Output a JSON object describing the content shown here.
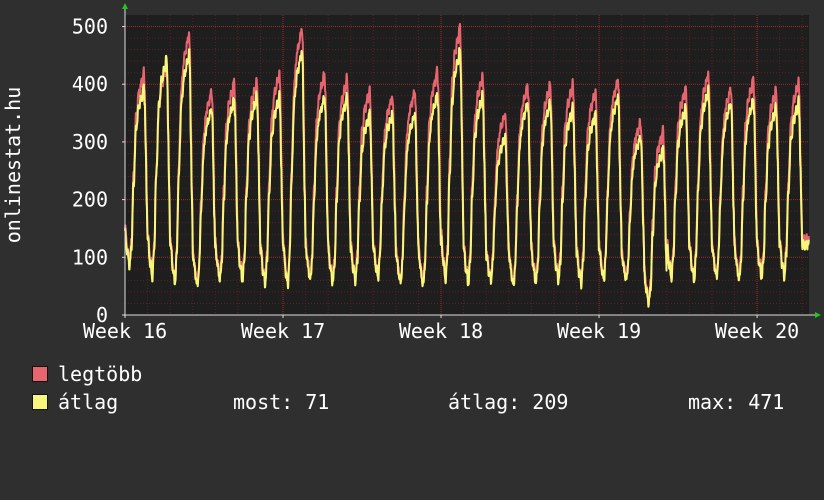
{
  "chart_data": {
    "type": "line",
    "ylabel": "onlinestat.hu",
    "ylim": [
      0,
      520
    ],
    "yticks": [
      0,
      100,
      200,
      300,
      400,
      500
    ],
    "grid": true,
    "xticks": [
      {
        "label": "Week 16",
        "at": 0
      },
      {
        "label": "Week 17",
        "at": 7
      },
      {
        "label": "Week 18",
        "at": 14
      },
      {
        "label": "Week 19",
        "at": 21
      },
      {
        "label": "Week 20",
        "at": 28
      }
    ],
    "xlim": [
      0,
      30.3
    ],
    "series": [
      {
        "name": "legtöbb",
        "color": "#e8656f",
        "daily_peak": [
          420,
          435,
          490,
          390,
          405,
          405,
          420,
          500,
          420,
          410,
          390,
          380,
          390,
          425,
          500,
          415,
          350,
          400,
          400,
          400,
          390,
          410,
          335,
          320,
          395,
          420,
          395,
          410,
          390,
          405
        ],
        "daily_low": [
          90,
          75,
          60,
          55,
          65,
          65,
          60,
          55,
          65,
          60,
          65,
          70,
          60,
          55,
          65,
          60,
          65,
          55,
          60,
          65,
          60,
          65,
          65,
          25,
          70,
          65,
          70,
          65,
          70,
          70
        ]
      },
      {
        "name": "átlag",
        "color": "#f7f77b",
        "daily_peak": [
          395,
          445,
          455,
          360,
          375,
          380,
          380,
          460,
          380,
          380,
          350,
          350,
          350,
          385,
          460,
          380,
          310,
          370,
          370,
          360,
          350,
          380,
          310,
          290,
          360,
          390,
          370,
          375,
          360,
          370
        ],
        "daily_low": [
          85,
          65,
          55,
          50,
          60,
          60,
          55,
          50,
          60,
          55,
          60,
          65,
          55,
          50,
          60,
          55,
          60,
          50,
          55,
          60,
          55,
          60,
          60,
          20,
          65,
          60,
          65,
          60,
          65,
          68
        ]
      }
    ]
  },
  "legend": {
    "max_label": "legtöbb",
    "avg_label": "átlag",
    "now_text": "most: 71",
    "avg_text": "átlag: 209",
    "max_text": "max: 471"
  },
  "colors": {
    "background": "#2f2f2f",
    "plot_background": "#1e1e1e",
    "grid": "#9a2c2c",
    "axis": "#dddddd",
    "arrow": "#1ec81e"
  }
}
